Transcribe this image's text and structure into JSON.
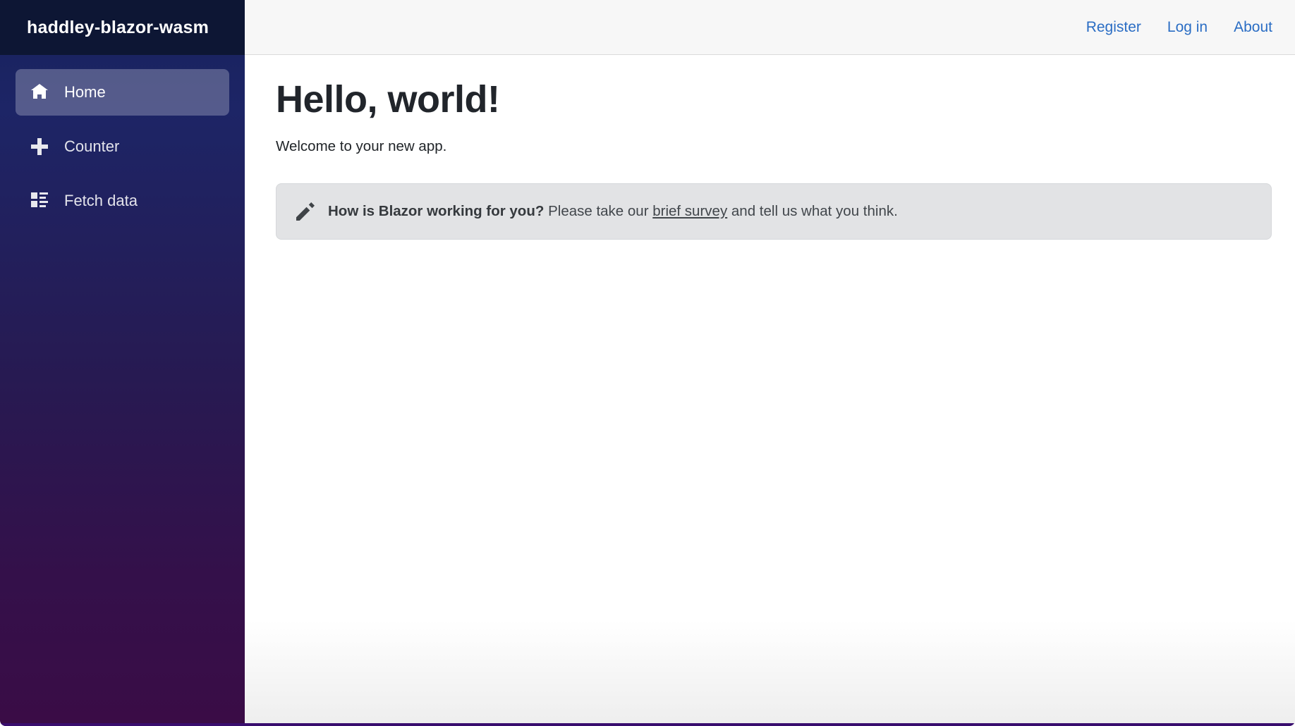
{
  "brand": {
    "title": "haddley-blazor-wasm"
  },
  "top_bar": {
    "links": [
      {
        "label": "Register"
      },
      {
        "label": "Log in"
      },
      {
        "label": "About"
      }
    ]
  },
  "sidebar": {
    "items": [
      {
        "label": "Home",
        "icon": "home-icon",
        "active": true
      },
      {
        "label": "Counter",
        "icon": "plus-icon",
        "active": false
      },
      {
        "label": "Fetch data",
        "icon": "list-rich-icon",
        "active": false
      }
    ]
  },
  "main": {
    "heading": "Hello, world!",
    "welcome": "Welcome to your new app.",
    "survey": {
      "icon": "pencil-icon",
      "bold_text": "How is Blazor working for you?",
      "text_before_link": " Please take our ",
      "link_text": "brief survey",
      "text_after_link": " and tell us what you think."
    }
  },
  "colors": {
    "brand_bg": "#0d1634",
    "sidebar_gradient_top": "#1a2361",
    "sidebar_gradient_bottom": "#3a0c46",
    "active_item_bg": "rgba(255,255,255,0.25)",
    "top_bar_bg": "#f7f7f7",
    "link_blue": "#2a6dc4",
    "alert_bg": "#e2e3e5",
    "alert_border": "#d6d8db",
    "alert_text": "#41464b",
    "bottom_strip": "#390d6e"
  }
}
